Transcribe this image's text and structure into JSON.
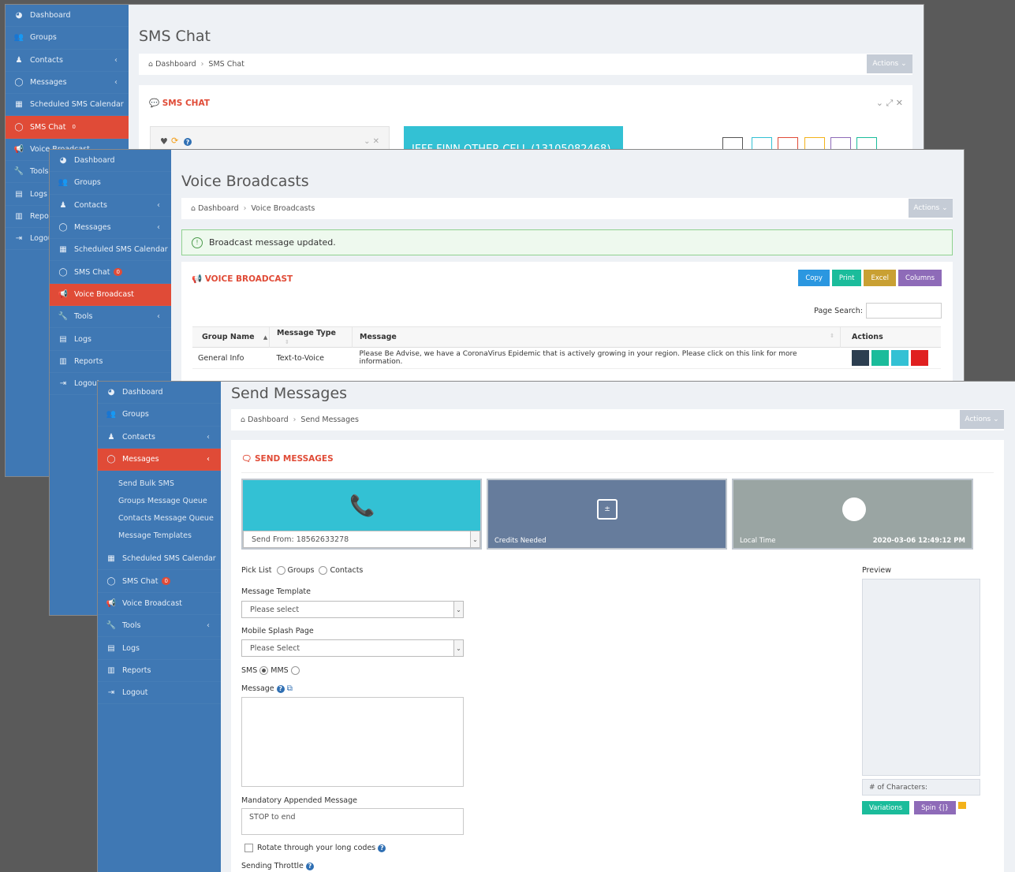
{
  "sidebar_common": {
    "dashboard": "Dashboard",
    "groups": "Groups",
    "contacts": "Contacts",
    "messages": "Messages",
    "scheduled": "Scheduled SMS Calendar",
    "sms_chat": "SMS Chat",
    "sms_chat_badge": "0",
    "voice_broadcast": "Voice Broadcast",
    "tools": "Tools",
    "logs": "Logs",
    "reports": "Reports",
    "logout": "Logout",
    "tools_short": "Tools",
    "logs_short": "Logs",
    "reports_short": "Repor",
    "logout_short": "Logou"
  },
  "messages_submenu": [
    "Send Bulk SMS",
    "Groups Message Queue",
    "Contacts Message Queue",
    "Message Templates"
  ],
  "win1": {
    "title": "SMS Chat",
    "crumb_home": "Dashboard",
    "crumb_current": "SMS Chat",
    "actions": "Actions",
    "panel_title": "SMS CHAT",
    "contact_name": "JEFF FINN OTHER CELL (13105082468)"
  },
  "win2": {
    "title": "Voice Broadcasts",
    "crumb_home": "Dashboard",
    "crumb_current": "Voice Broadcasts",
    "actions": "Actions",
    "alert": "Broadcast message updated.",
    "panel_title": "VOICE BROADCAST",
    "buttons": {
      "copy": "Copy",
      "print": "Print",
      "excel": "Excel",
      "columns": "Columns"
    },
    "page_search_label": "Page Search:",
    "table": {
      "headers": [
        "Group Name",
        "Message Type",
        "Message",
        "Actions"
      ],
      "rows": [
        [
          "General Info",
          "Text-to-Voice",
          "Please Be Advise, we have a CoronaVirus Epidemic that is actively growing in your region. Please click on this link for more information."
        ]
      ]
    }
  },
  "win3": {
    "title": "Send Messages",
    "crumb_home": "Dashboard",
    "crumb_current": "Send Messages",
    "actions": "Actions",
    "panel_title": "SEND MESSAGES",
    "send_from": "Send From: 18562633278",
    "credits_label": "Credits Needed",
    "local_time_label": "Local Time",
    "local_time_value": "2020-03-06 12:49:12 PM",
    "pick_list": "Pick List",
    "groups": "Groups",
    "contacts": "Contacts",
    "message_template_label": "Message Template",
    "message_template_value": "Please select",
    "splash_label": "Mobile Splash Page",
    "splash_value": "Please Select",
    "sms": "SMS",
    "mms": "MMS",
    "message_label": "Message",
    "appended_label": "Mandatory Appended Message",
    "appended_value": "STOP to end",
    "rotate_label": "Rotate through your long codes",
    "throttle_label": "Sending Throttle",
    "preview_label": "Preview",
    "chars_label": "# of Characters:",
    "variations": "Variations",
    "spin": "Spin {|}"
  },
  "colors": {
    "sidebar": "#3f78b4",
    "active": "#e04b37",
    "teal": "#33c1d4",
    "slate": "#667c9c",
    "gray_tile": "#9aa5a3",
    "green": "#1bbc9b",
    "purple": "#8e6bb8"
  }
}
